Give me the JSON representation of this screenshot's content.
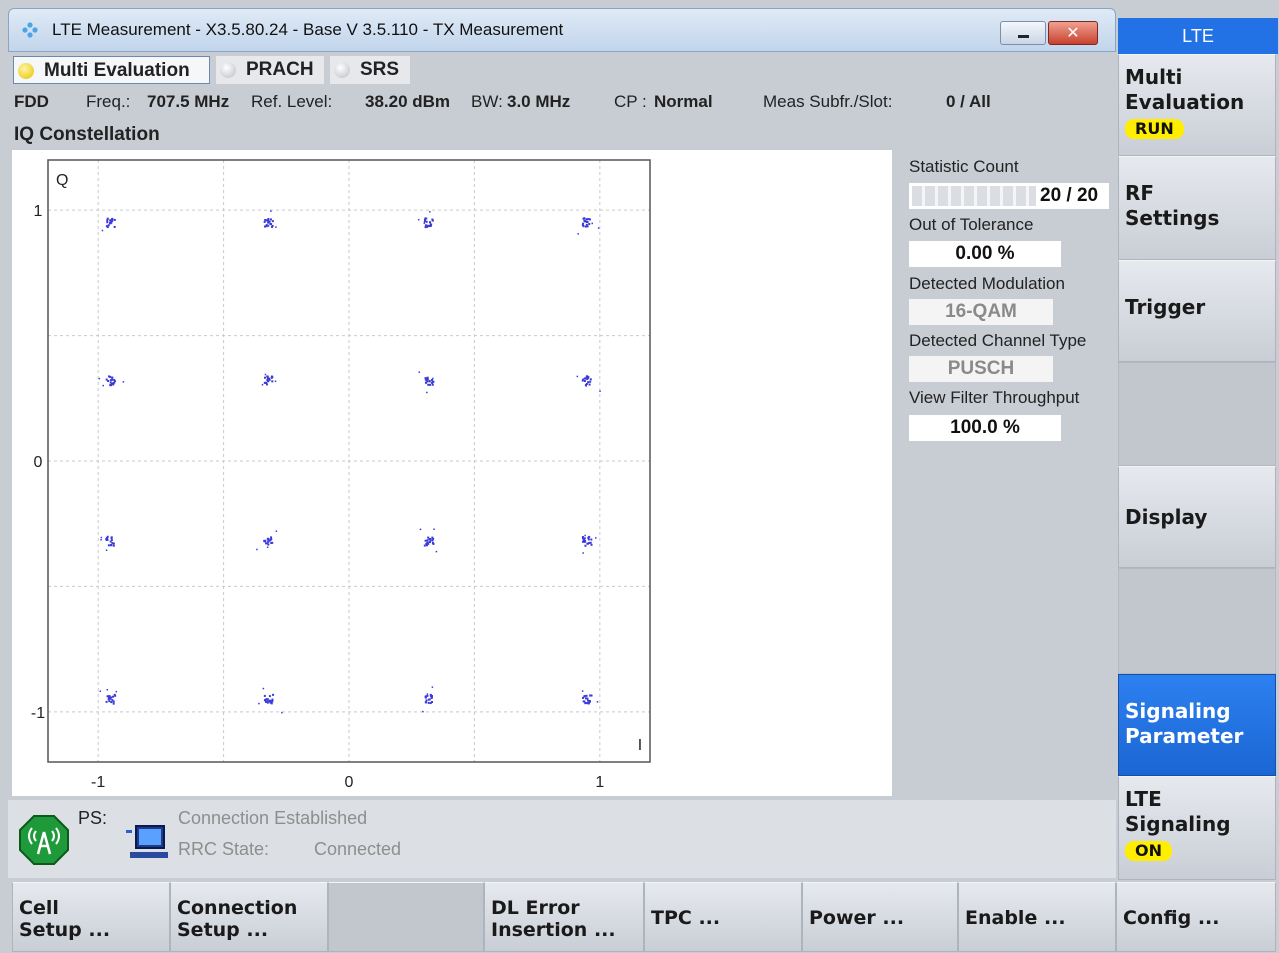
{
  "window": {
    "title": "LTE Measurement  - X3.5.80.24 - Base V 3.5.110 - TX Measurement",
    "close_glyph": "✕"
  },
  "tabs": [
    {
      "label": "Multi Evaluation",
      "active": true
    },
    {
      "label": "PRACH",
      "active": false
    },
    {
      "label": "SRS",
      "active": false
    }
  ],
  "info": {
    "duplex": "FDD",
    "freq_label": "Freq.:",
    "freq_value": "707.5 MHz",
    "ref_label": "Ref. Level:",
    "ref_value": "38.20 dBm",
    "bw_label": "BW:",
    "bw_value": "3.0 MHz",
    "cp_label": "CP :",
    "cp_value": "Normal",
    "meas_label": "Meas Subfr./Slot:",
    "meas_value": "0  / All"
  },
  "section_title": "IQ Constellation",
  "chart_data": {
    "type": "scatter",
    "title": "IQ Constellation",
    "xlabel": "I",
    "ylabel": "Q",
    "xlim": [
      -1.2,
      1.2
    ],
    "ylim": [
      -1.2,
      1.2
    ],
    "x_ticks": [
      "-1",
      "0",
      "1"
    ],
    "y_ticks": [
      "1",
      "0",
      "-1"
    ],
    "grid": true,
    "series": [
      {
        "color": "#3a3ad8",
        "points": [
          [
            -0.95,
            0.95
          ],
          [
            -0.32,
            0.95
          ],
          [
            0.32,
            0.95
          ],
          [
            0.95,
            0.95
          ],
          [
            -0.95,
            0.32
          ],
          [
            -0.32,
            0.32
          ],
          [
            0.32,
            0.32
          ],
          [
            0.95,
            0.32
          ],
          [
            -0.95,
            -0.32
          ],
          [
            -0.32,
            -0.32
          ],
          [
            0.32,
            -0.32
          ],
          [
            0.95,
            -0.32
          ],
          [
            -0.95,
            -0.95
          ],
          [
            -0.32,
            -0.95
          ],
          [
            0.32,
            -0.95
          ],
          [
            0.95,
            -0.95
          ]
        ]
      }
    ]
  },
  "stats": {
    "statistic_count_label": "Statistic Count",
    "statistic_count_value": "20 / 20",
    "statistic_count_fraction": 1.0,
    "out_of_tolerance_label": "Out of Tolerance",
    "out_of_tolerance_value": "0.00  %",
    "detected_modulation_label": "Detected Modulation",
    "detected_modulation_value": "16-QAM",
    "detected_channel_label": "Detected Channel Type",
    "detected_channel_value": "PUSCH",
    "view_filter_label": "View Filter Throughput",
    "view_filter_value": "100.0  %"
  },
  "status": {
    "ps_label": "PS:",
    "connection": "Connection Established",
    "rrc_label": "RRC State:",
    "rrc_value": "Connected"
  },
  "right_softkeys": {
    "header": "LTE",
    "multi_evaluation": "Multi\nEvaluation",
    "multi_evaluation_badge": "RUN",
    "rf_settings": "RF\nSettings",
    "trigger": "Trigger",
    "display": "Display",
    "signaling_parameter": "Signaling\nParameter",
    "lte_signaling": "LTE\nSignaling",
    "lte_signaling_badge": "ON"
  },
  "bottom_softkeys": {
    "cell_setup": "Cell\nSetup ...",
    "connection_setup": "Connection\nSetup ...",
    "dl_error_insertion": "DL Error\nInsertion ...",
    "tpc": "TPC ...",
    "power": "Power ...",
    "enable": "Enable ...",
    "config": "Config ..."
  },
  "colors": {
    "accent": "#2272e6",
    "badge": "#ffee00",
    "points": "#3a3ad8"
  }
}
